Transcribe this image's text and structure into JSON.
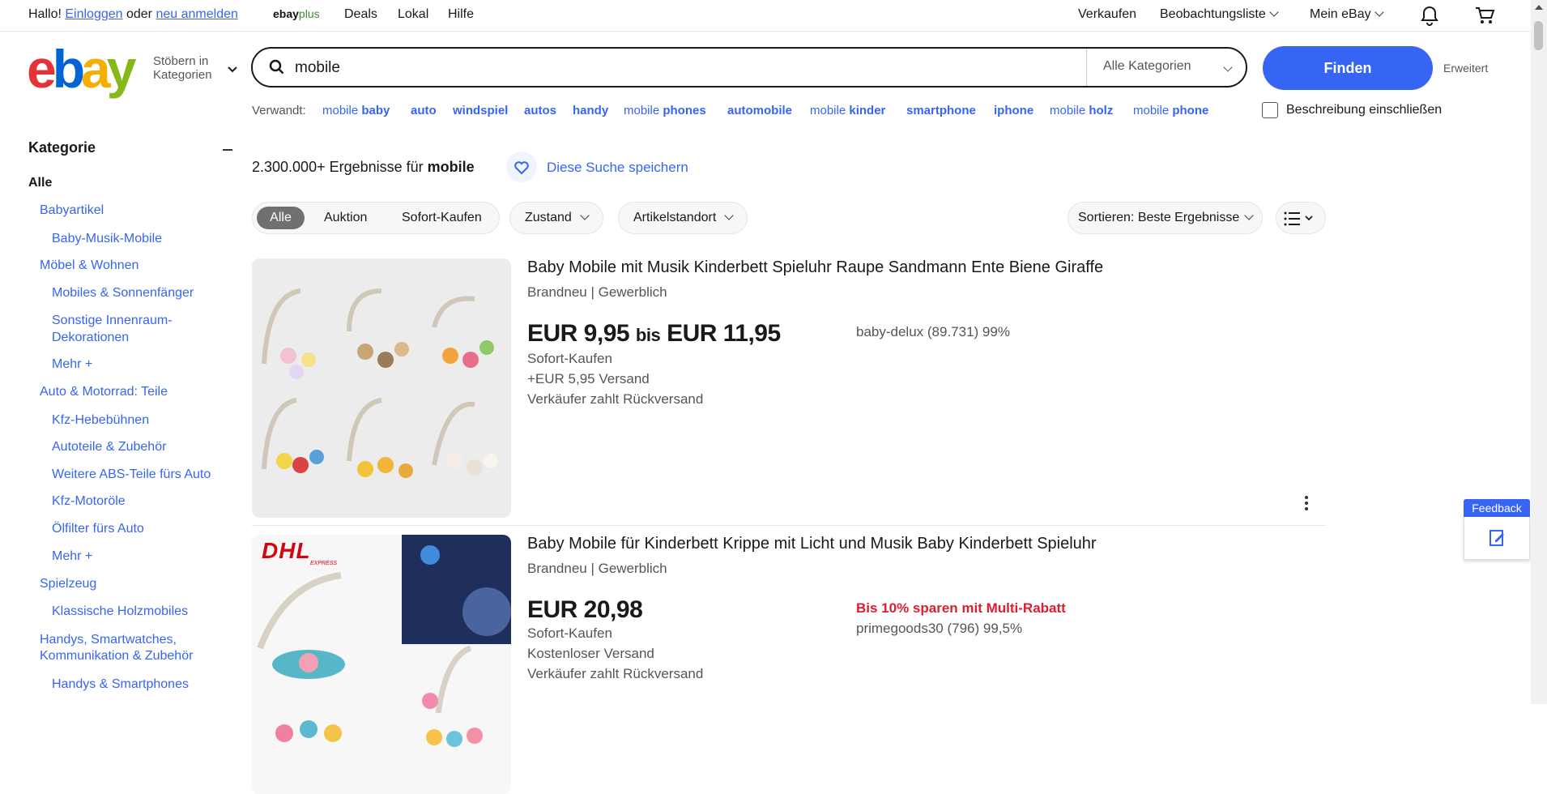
{
  "topbar": {
    "greeting": "Hallo!",
    "login": "Einloggen",
    "or": "oder",
    "register": "neu anmelden",
    "ebayplus_a": "ebay",
    "ebayplus_b": "plus",
    "nav": [
      "Deals",
      "Lokal",
      "Hilfe"
    ],
    "sell": "Verkaufen",
    "watchlist": "Beobachtungsliste",
    "my_ebay": "Mein eBay",
    "icons": [
      "bell-icon",
      "cart-icon"
    ]
  },
  "header": {
    "logo": {
      "e": "e",
      "b": "b",
      "a": "a",
      "y": "y"
    },
    "browse_line1": "Stöbern in",
    "browse_line2": "Kategorien",
    "search_value": "mobile",
    "category": "Alle Kategorien",
    "find": "Finden",
    "advanced": "Erweitert",
    "include_description": "Beschreibung einschließen"
  },
  "related": {
    "label": "Verwandt:",
    "items": [
      {
        "pre": "mobile ",
        "bold": "baby"
      },
      {
        "pre": "",
        "bold": "auto"
      },
      {
        "pre": "",
        "bold": "windspiel"
      },
      {
        "pre": "",
        "bold": "autos"
      },
      {
        "pre": "",
        "bold": "handy"
      },
      {
        "pre": "mobile ",
        "bold": "phones"
      },
      {
        "pre": "",
        "bold": "automobile"
      },
      {
        "pre": "mobile ",
        "bold": "kinder"
      },
      {
        "pre": "",
        "bold": "smartphone"
      },
      {
        "pre": "",
        "bold": "iphone"
      },
      {
        "pre": "mobile ",
        "bold": "holz"
      },
      {
        "pre": "mobile ",
        "bold": "phone"
      }
    ]
  },
  "sidebar": {
    "heading": "Kategorie",
    "all": "Alle",
    "items": [
      "Babyartikel",
      "Baby-Musik-Mobile",
      "Möbel & Wohnen",
      "Mobiles & Sonnenfänger",
      "Sonstige Innenraum-",
      "Dekorationen",
      "Mehr +",
      "Auto & Motorrad: Teile",
      "Kfz-Hebebühnen",
      "Autoteile & Zubehör",
      "Weitere ABS-Teile fürs Auto",
      "Kfz-Motoröle",
      "Ölfilter fürs Auto",
      "Mehr +",
      "Spielzeug",
      "Klassische Holzmobiles",
      "Handys, Smartwatches,",
      "Kommunikation & Zubehör",
      "Handys & Smartphones"
    ]
  },
  "results": {
    "count_prefix": "2.300.000+ Ergebnisse für ",
    "count_query": "mobile",
    "save_search": "Diese Suche speichern",
    "filters": {
      "all": "Alle",
      "auction": "Auktion",
      "buy_now": "Sofort-Kaufen",
      "condition": "Zustand",
      "location": "Artikelstandort"
    },
    "sort": "Sortieren: Beste Ergebnisse"
  },
  "listings": [
    {
      "title": "Baby Mobile mit Musik Kinderbett Spieluhr Raupe Sandmann Ente Biene Giraffe",
      "condition": "Brandneu | Gewerblich",
      "price_from": "EUR 9,95",
      "price_bis": "bis",
      "price_to": "EUR 11,95",
      "format": "Sofort-Kaufen",
      "shipping": "+EUR 5,95 Versand",
      "returns": "Verkäufer zahlt Rückversand",
      "seller": "baby-delux (89.731) 99%"
    },
    {
      "title": "Baby Mobile für Kinderbett Krippe mit Licht und Musik Baby Kinderbett Spieluhr",
      "condition": "Brandneu | Gewerblich",
      "price": "EUR 20,98",
      "format": "Sofort-Kaufen",
      "shipping": "Kostenloser Versand",
      "returns": "Verkäufer zahlt Rückversand",
      "promo": "Bis 10% sparen mit Multi-Rabatt",
      "seller": "primegoods30 (796) 99,5%",
      "badge": "DHL",
      "badge_sub": "EXPRESS"
    }
  ],
  "feedback": "Feedback",
  "colors": {
    "accent": "#3665f3",
    "promo": "#dd1e31"
  }
}
